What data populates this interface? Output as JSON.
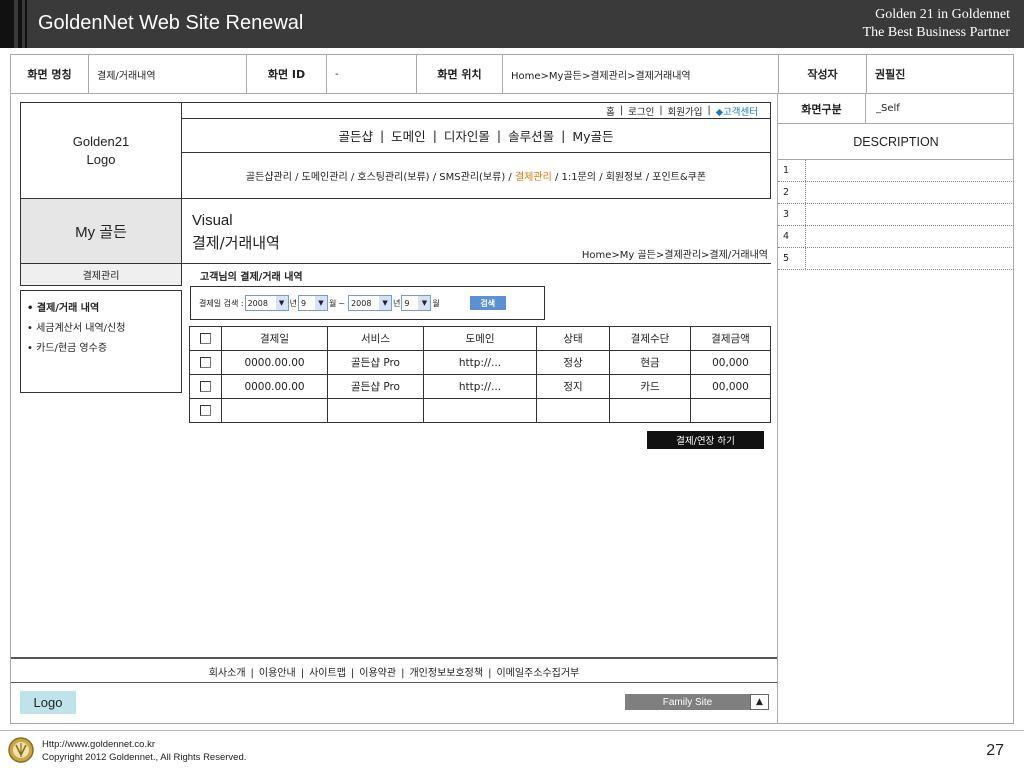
{
  "banner": {
    "title": "GoldenNet Web Site Renewal",
    "tagline_1": "Golden 21 in Goldennet",
    "tagline_2": "The Best Business Partner"
  },
  "info": {
    "screen_name_label": "화면 명칭",
    "screen_name_value": "결제/거래내역",
    "screen_id_label": "화면 ID",
    "screen_id_value": "-",
    "screen_location_label": "화면 위치",
    "screen_location_value": "Home>My골든>결제관리>결제거래내역",
    "author_label": "작성자",
    "author_value": "권필진"
  },
  "wireframe": {
    "logo_line1": "Golden21",
    "logo_line2": "Logo",
    "util": {
      "home": "홈",
      "login": "로그인",
      "join": "회원가입",
      "customer_center": "◆고객센터",
      "separator": "|"
    },
    "gnb": [
      "골든샵",
      "도메인",
      "디자인몰",
      "솔루션몰",
      "My골든"
    ],
    "gnb_separator": "|",
    "sub_nav": {
      "before": "골든샵관리 / 도메인관리 / 호스팅관리(보류) / SMS관리(보류) /",
      "active": "결제관리",
      "after": "/ 1:1문의 / 회원정보 / 포인트&쿠폰"
    },
    "lnb_title": "My 골든",
    "visual_title": "Visual",
    "visual_subtitle": "결제/거래내역",
    "visual_breadcrumb": "Home>My 골든>결제관리>결제/거래내역",
    "lnb_category": "결제관리",
    "lnb_items": [
      {
        "label": "• 결제/거래 내역"
      },
      {
        "label": "• 세금계산서 내역/신청"
      },
      {
        "label": "• 카드/현금 영수증"
      }
    ],
    "section_title": "고객님의 결제/거래 내역",
    "search": {
      "label": "결제일 검색 :",
      "from_year": "2008",
      "year_unit": "년",
      "from_month": "9",
      "month_unit": "월",
      "tilde": "~",
      "to_year": "2008",
      "to_month": "9",
      "button": "검색"
    },
    "table": {
      "headers": [
        "결제일",
        "서비스",
        "도메인",
        "상태",
        "결제수단",
        "결제금액"
      ],
      "rows": [
        [
          "0000.00.00",
          "골든샵 Pro",
          "http://...",
          "정상",
          "현금",
          "00,000"
        ],
        [
          "0000.00.00",
          "골든샵 Pro",
          "http://...",
          "정지",
          "카드",
          "00,000"
        ],
        [
          "",
          "",
          "",
          "",
          "",
          ""
        ]
      ]
    },
    "renew_button": "결제/연장 하기",
    "footer_links": [
      "회사소개",
      "이용안내",
      "사이트맵",
      "이용약관",
      "개인정보보호정책",
      "이메일주소수집거부"
    ],
    "footer_separator": "|",
    "footer_logo": "Logo",
    "family_site": "Family Site",
    "family_site_arrow": "▲"
  },
  "description": {
    "screen_type_label": "화면구분",
    "screen_type_value": "_Self",
    "title": "DESCRIPTION",
    "rows": [
      "1",
      "2",
      "3",
      "4",
      "5"
    ]
  },
  "bottom": {
    "url": "Http://www.goldennet.co.kr",
    "copyright": "Copyright 2012 Goldennet., All Rights Reserved.",
    "page_number": "27"
  },
  "colors": {
    "banner_bg": "#3a3a3a",
    "active_menu": "#e07800",
    "customer_center": "#1a7bbf",
    "search_button": "#5a90d6",
    "footer_logo_bg": "#bfe3ea",
    "lnb_title_bg": "#e6e6e6"
  }
}
